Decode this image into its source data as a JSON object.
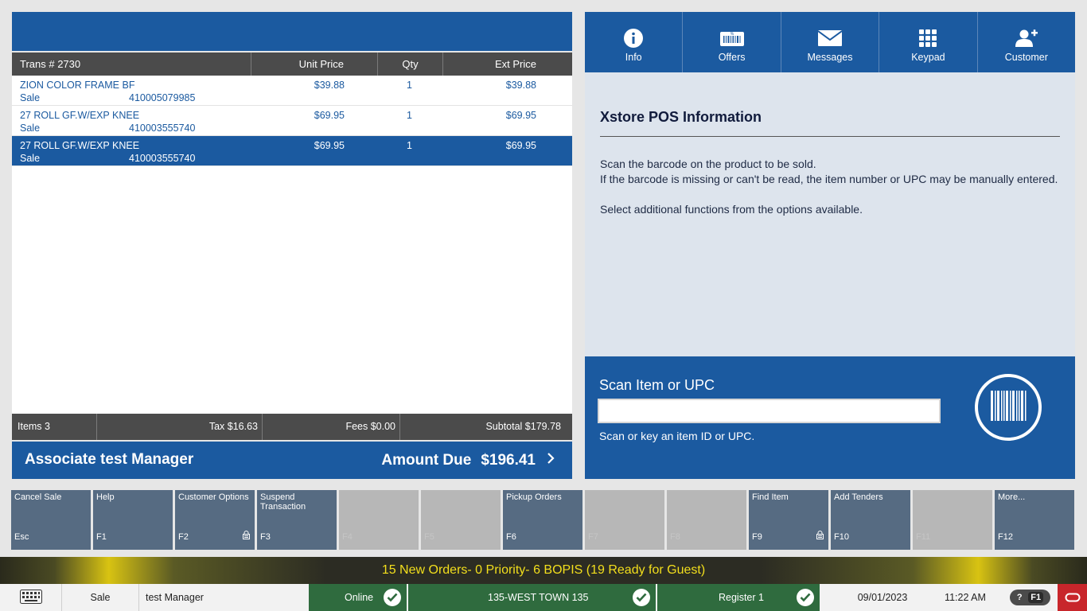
{
  "transaction": {
    "columns": {
      "trans": "Trans #  2730",
      "unit_price": "Unit Price",
      "qty": "Qty",
      "ext_price": "Ext Price"
    },
    "items": [
      {
        "desc": "ZION COLOR FRAME BF",
        "type": "Sale",
        "sku": "410005079985",
        "unit_price": "$39.88",
        "qty": "1",
        "ext_price": "$39.88",
        "selected": false
      },
      {
        "desc": "27 ROLL GF.W/EXP KNEE",
        "type": "Sale",
        "sku": "410003555740",
        "unit_price": "$69.95",
        "qty": "1",
        "ext_price": "$69.95",
        "selected": false
      },
      {
        "desc": "27 ROLL GF.W/EXP KNEE",
        "type": "Sale",
        "sku": "410003555740",
        "unit_price": "$69.95",
        "qty": "1",
        "ext_price": "$69.95",
        "selected": true
      }
    ],
    "totals": {
      "items": "Items 3",
      "tax": "Tax $16.63",
      "fees": "Fees $0.00",
      "subtotal": "Subtotal $179.78"
    },
    "associate": "Associate test Manager",
    "amount_due_label": "Amount Due",
    "amount_due": "$196.41"
  },
  "tabs": [
    {
      "label": "Info",
      "icon": "info-icon",
      "active": true
    },
    {
      "label": "Offers",
      "icon": "offers-icon",
      "active": false
    },
    {
      "label": "Messages",
      "icon": "envelope-icon",
      "active": false
    },
    {
      "label": "Keypad",
      "icon": "keypad-icon",
      "active": false
    },
    {
      "label": "Customer",
      "icon": "add-customer-icon",
      "active": false
    }
  ],
  "info": {
    "title": "Xstore POS Information",
    "line1": "Scan the barcode on the product to be sold.",
    "line2": "If the barcode is missing or can't be read, the item number or UPC may be manually entered.",
    "line3": "Select additional functions from the options available."
  },
  "scan": {
    "title": "Scan Item or UPC",
    "value": "",
    "hint": "Scan or key an item ID or UPC."
  },
  "fkeys": [
    {
      "label": "Cancel Sale",
      "key": "Esc",
      "enabled": true,
      "lock": false
    },
    {
      "label": "Help",
      "key": "F1",
      "enabled": true,
      "lock": false
    },
    {
      "label": "Customer Options",
      "key": "F2",
      "enabled": true,
      "lock": true
    },
    {
      "label": "Suspend Transaction",
      "key": "F3",
      "enabled": true,
      "lock": false
    },
    {
      "label": "",
      "key": "F4",
      "enabled": false,
      "lock": false
    },
    {
      "label": "",
      "key": "F5",
      "enabled": false,
      "lock": false
    },
    {
      "label": "Pickup Orders",
      "key": "F6",
      "enabled": true,
      "lock": false
    },
    {
      "label": "",
      "key": "F7",
      "enabled": false,
      "lock": false
    },
    {
      "label": "",
      "key": "F8",
      "enabled": false,
      "lock": false
    },
    {
      "label": "Find Item",
      "key": "F9",
      "enabled": true,
      "lock": true
    },
    {
      "label": "Add Tenders",
      "key": "F10",
      "enabled": true,
      "lock": false
    },
    {
      "label": "",
      "key": "F11",
      "enabled": false,
      "lock": false
    },
    {
      "label": "More...",
      "key": "F12",
      "enabled": true,
      "lock": false
    }
  ],
  "notification": "15 New Orders- 0 Priority- 6 BOPIS (19 Ready for Guest)",
  "status": {
    "mode": "Sale",
    "user": "test Manager",
    "online": "Online",
    "store": "135-WEST TOWN 135",
    "register": "Register 1",
    "date": "09/01/2023",
    "time": "11:22 AM",
    "help_q": "?",
    "help_key": "F1"
  },
  "colors": {
    "primary_blue": "#1b5aa0",
    "header_gray": "#4b4b4b",
    "fkey_slate": "#566b82",
    "status_green": "#2f6b3e",
    "notify_yellow": "#f3df1c",
    "oracle_red": "#c8262b"
  }
}
